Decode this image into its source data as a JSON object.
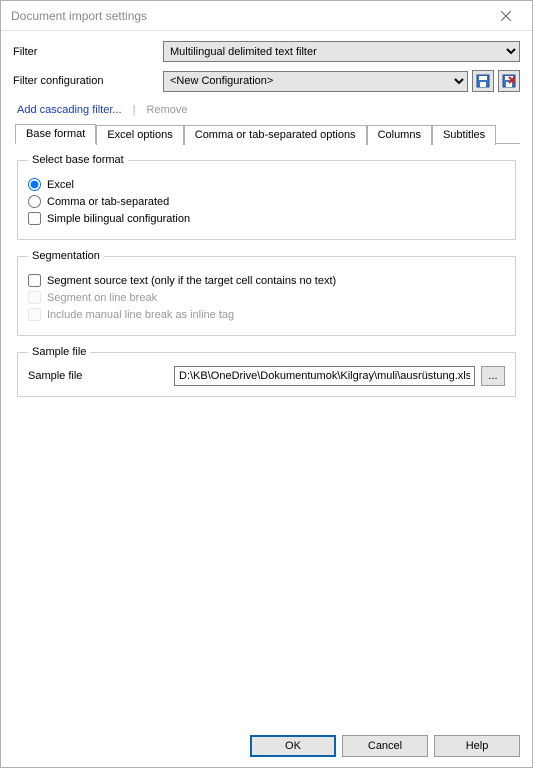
{
  "window": {
    "title": "Document import settings"
  },
  "filter": {
    "label": "Filter",
    "selected": "Multilingual delimited text filter"
  },
  "config": {
    "label": "Filter configuration",
    "selected": "<New Configuration>"
  },
  "links": {
    "add_cascading": "Add cascading filter...",
    "remove": "Remove"
  },
  "tabs": [
    {
      "id": "base",
      "label": "Base format",
      "active": true
    },
    {
      "id": "excel",
      "label": "Excel options",
      "active": false
    },
    {
      "id": "csv",
      "label": "Comma or tab-separated options",
      "active": false
    },
    {
      "id": "cols",
      "label": "Columns",
      "active": false
    },
    {
      "id": "subs",
      "label": "Subtitles",
      "active": false
    }
  ],
  "base_format": {
    "legend": "Select base format",
    "radio_excel": "Excel",
    "radio_csv": "Comma or tab-separated",
    "check_bilingual": "Simple bilingual configuration"
  },
  "segmentation": {
    "legend": "Segmentation",
    "seg_source": "Segment source text (only if the target cell contains no text)",
    "seg_line": "Segment on line break",
    "seg_inline": "Include manual line break as inline tag"
  },
  "sample": {
    "legend": "Sample file",
    "label": "Sample file",
    "path": "D:\\KB\\OneDrive\\Dokumentumok\\Kilgray\\muli\\ausrüstung.xlsx",
    "browse": "..."
  },
  "buttons": {
    "ok": "OK",
    "cancel": "Cancel",
    "help": "Help"
  }
}
